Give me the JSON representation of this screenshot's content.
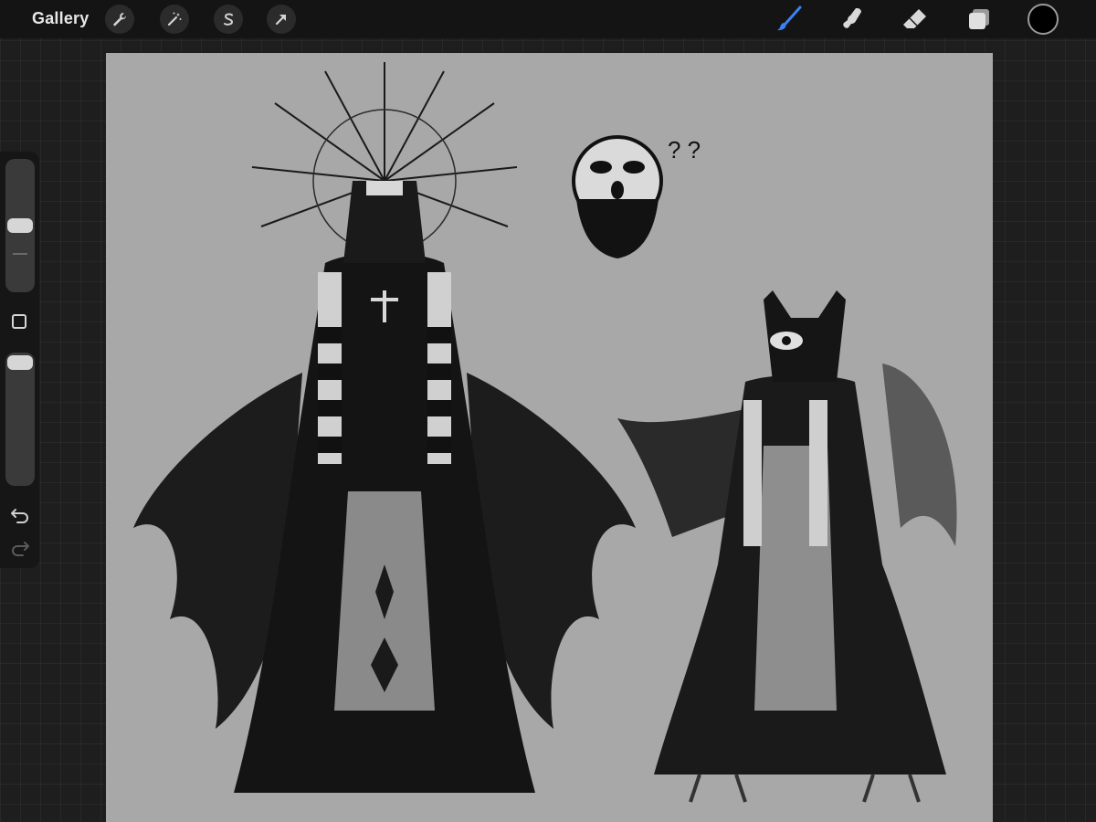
{
  "app": {
    "gallery_label": "Gallery"
  },
  "toolbar": {
    "left_tools": [
      {
        "name": "actions",
        "icon": "wrench-icon"
      },
      {
        "name": "adjustments",
        "icon": "magic-wand-icon"
      },
      {
        "name": "selection",
        "icon": "selection-s-icon"
      },
      {
        "name": "transform",
        "icon": "arrow-cursor-icon"
      }
    ],
    "right_tools": [
      {
        "name": "brush",
        "icon": "brush-icon",
        "active": true
      },
      {
        "name": "smudge",
        "icon": "smudge-finger-icon",
        "active": false
      },
      {
        "name": "eraser",
        "icon": "eraser-icon",
        "active": false
      },
      {
        "name": "layers",
        "icon": "layers-icon",
        "active": false
      }
    ],
    "current_color": "#000000",
    "active_accent": "#3b82f6"
  },
  "sidebar": {
    "brush_size_level": 0.35,
    "opacity_level": 0.92,
    "modify_button_icon": "square-icon",
    "undo_icon": "undo-icon",
    "redo_icon": "redo-icon"
  },
  "canvas": {
    "background_color": "#a8a8a8",
    "artwork_description_icon": "artwork-illustration",
    "annotation_text": "? ?"
  }
}
